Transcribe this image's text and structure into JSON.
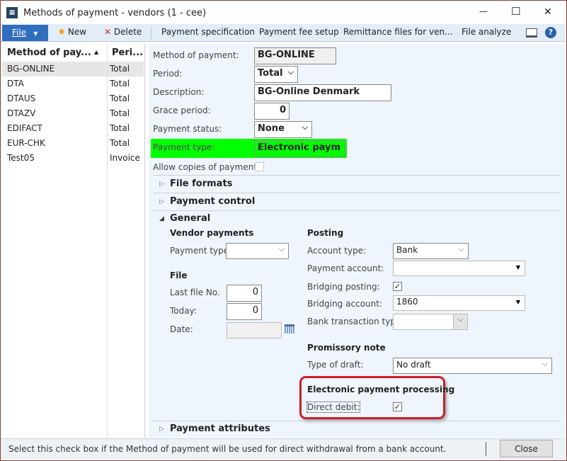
{
  "window": {
    "title": "Methods of payment - vendors (1 - cee)",
    "minimize": "—",
    "maximize": "☐",
    "close": "✕"
  },
  "toolbar": {
    "file": "File",
    "new": "New",
    "delete": "Delete",
    "items": [
      "Payment specification",
      "Payment fee setup",
      "Remittance files for ven...",
      "File analyze"
    ]
  },
  "grid": {
    "columns": [
      "Method of pay...",
      "Peri..."
    ],
    "rows": [
      [
        "BG-ONLINE",
        "Total"
      ],
      [
        "DTA",
        "Total"
      ],
      [
        "DTAUS",
        "Total"
      ],
      [
        "DTAZV",
        "Total"
      ],
      [
        "EDIFACT",
        "Total"
      ],
      [
        "EUR-CHK",
        "Total"
      ],
      [
        "Test05",
        "Invoice"
      ]
    ]
  },
  "header": {
    "method_label": "Method of payment:",
    "method_value": "BG-ONLINE",
    "period_label": "Period:",
    "period_value": "Total",
    "description_label": "Description:",
    "description_value": "BG-Online Denmark",
    "grace_label": "Grace period:",
    "grace_value": "0",
    "status_label": "Payment status:",
    "status_value": "None",
    "type_label": "Payment type:",
    "type_value": "Electronic paym",
    "copies_label": "Allow copies of payments:",
    "highlight_color": "#00ff00"
  },
  "sections": {
    "file_formats": "File formats",
    "payment_control": "Payment control",
    "general": "General",
    "payment_attributes": "Payment attributes"
  },
  "general": {
    "vendor_payments": "Vendor payments",
    "payment_type_label": "Payment type:",
    "payment_type_value": "",
    "file": "File",
    "last_file_label": "Last file No.",
    "last_file_value": "0",
    "today_label": "Today:",
    "today_value": "0",
    "date_label": "Date:",
    "posting": "Posting",
    "account_type_label": "Account type:",
    "account_type_value": "Bank",
    "payment_account_label": "Payment account:",
    "payment_account_value": "",
    "bridging_posting_label": "Bridging posting:",
    "bridging_posting_checked": true,
    "bridging_account_label": "Bridging account:",
    "bridging_account_value": "1860",
    "bank_trans_label": "Bank transaction type:",
    "promissory": "Promissory note",
    "draft_label": "Type of draft:",
    "draft_value": "No draft",
    "epp": "Electronic payment processing",
    "direct_debit_label": "Direct debit:",
    "direct_debit_checked": true,
    "annotation_color": "#c8202a"
  },
  "status": {
    "text": "Select this check box if the Method of payment will be used for direct withdrawal from a bank account.",
    "close": "Close"
  }
}
